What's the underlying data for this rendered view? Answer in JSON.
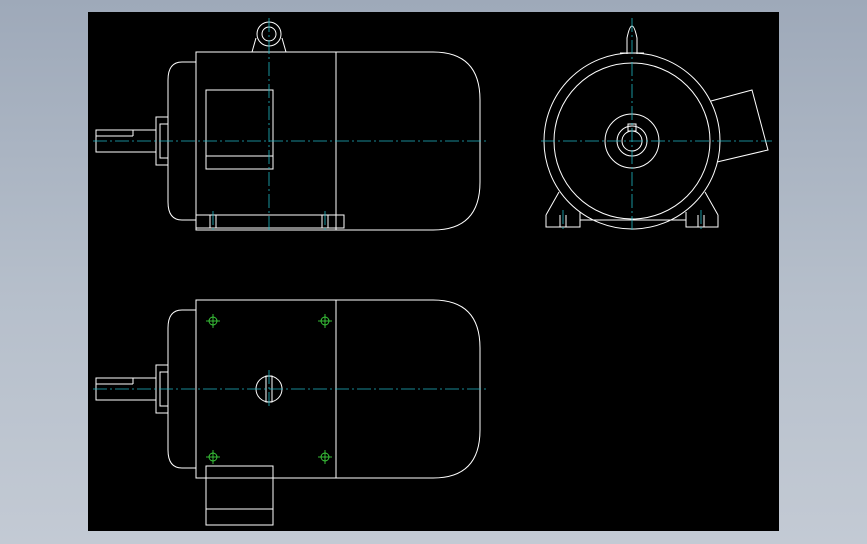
{
  "colors": {
    "background_outer": "#b6bfcb",
    "viewport": "#000000",
    "outline": "#ffffff",
    "centerline": "#1fb7c3",
    "bolt_marks": "#3ccf3c"
  },
  "drawing": {
    "subject": "electric motor",
    "views": [
      "side-view",
      "end-view",
      "top-view"
    ]
  }
}
